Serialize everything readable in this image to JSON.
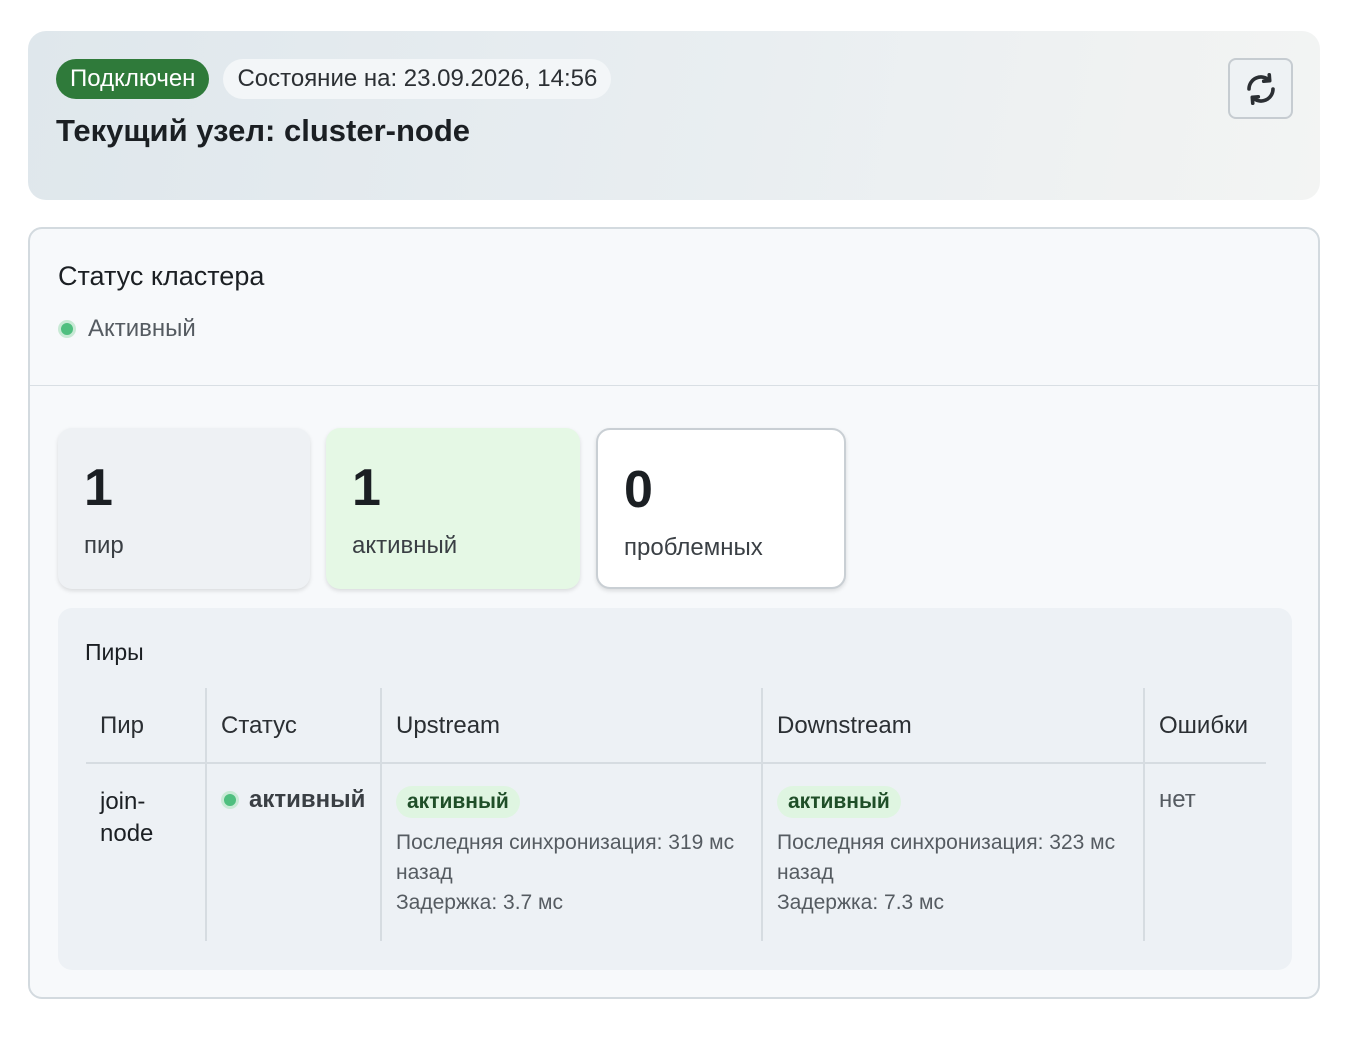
{
  "header": {
    "connection_badge": "Подключен",
    "state_time": "Состояние на: 23.09.2026, 14:56",
    "node_title": "Текущий узел: cluster-node",
    "refresh_icon": "refresh-icon"
  },
  "cluster": {
    "title": "Статус кластера",
    "status": "Активный",
    "status_color": "#4fbf7f"
  },
  "stats": [
    {
      "value": "1",
      "label": "пир"
    },
    {
      "value": "1",
      "label": "активный"
    },
    {
      "value": "0",
      "label": "проблемных"
    }
  ],
  "peers": {
    "title": "Пиры",
    "columns": [
      "Пир",
      "Статус",
      "Upstream",
      "Downstream",
      "Ошибки"
    ],
    "rows": [
      {
        "peer": "join-node",
        "status": "активный",
        "upstream": {
          "state": "активный",
          "sync": "Последняя синхронизация: 319 мс назад",
          "latency": "Задержка: 3.7 мс"
        },
        "downstream": {
          "state": "активный",
          "sync": "Последняя синхронизация: 323 мс назад",
          "latency": "Задержка: 7.3 мс"
        },
        "errors": "нет"
      }
    ]
  },
  "colors": {
    "connected": "#2f7a3a",
    "active_dot": "#4fbf7f",
    "active_stat_bg": "#e5f8e5"
  }
}
